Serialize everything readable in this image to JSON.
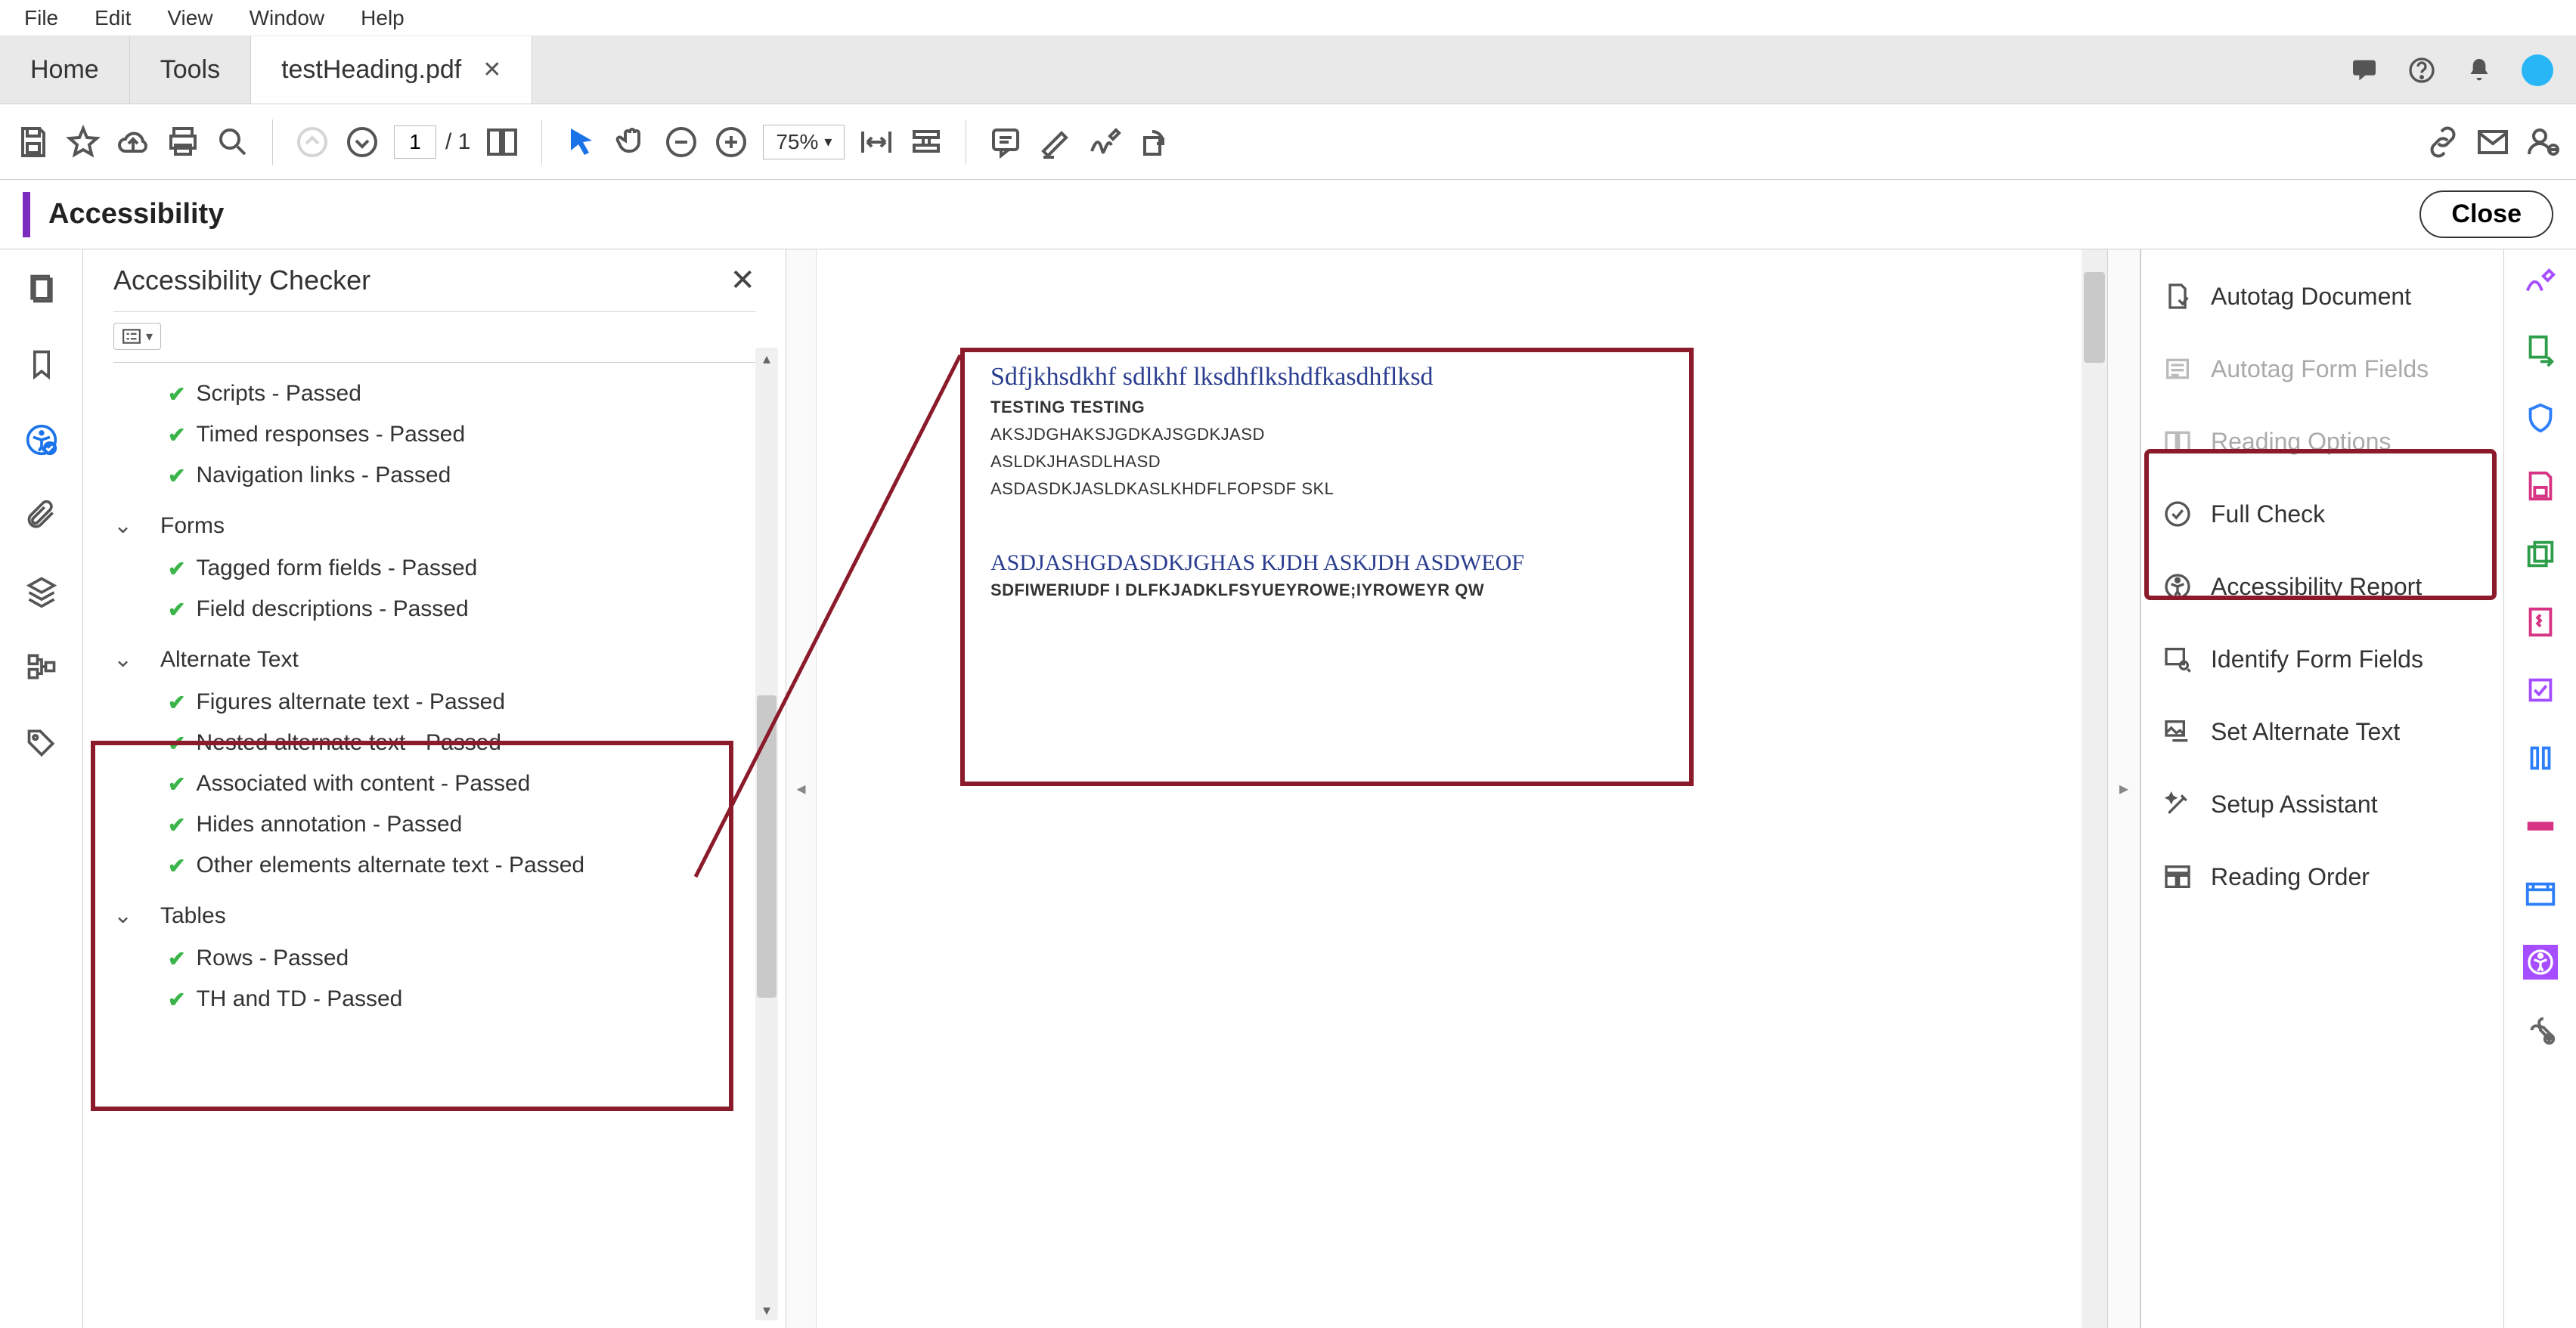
{
  "menu": {
    "file": "File",
    "edit": "Edit",
    "view": "View",
    "window": "Window",
    "help": "Help"
  },
  "tabs": {
    "home": "Home",
    "tools": "Tools",
    "doc": "testHeading.pdf"
  },
  "toolbar": {
    "page_current": "1",
    "page_total": "/  1",
    "zoom_value": "75%"
  },
  "panel": {
    "title": "Accessibility",
    "close": "Close"
  },
  "checker": {
    "title": "Accessibility Checker",
    "items_pre": [
      "Scripts - Passed",
      "Timed responses - Passed",
      "Navigation links - Passed"
    ],
    "group_forms": "Forms",
    "forms_items": [
      "Tagged form fields - Passed",
      "Field descriptions - Passed"
    ],
    "group_alt": "Alternate Text",
    "alt_items": [
      "Figures alternate text - Passed",
      "Nested alternate text - Passed",
      "Associated with content - Passed",
      "Hides annotation - Passed",
      "Other elements alternate text - Passed"
    ],
    "group_tables": "Tables",
    "tables_items": [
      "Rows - Passed",
      "TH and TD - Passed"
    ]
  },
  "doc": {
    "h1": "Sdfjkhsdkhf sdlkhf lksdhflkshdfkasdhflksd",
    "b1": "TESTING TESTING",
    "l1": "AKSJDGHAKSJGDKAJSGDKJASD",
    "l2": "ASLDKJHASDLHASD",
    "l3": "ASDASDKJASLDKASLKHDFLFOPSDF SKL",
    "h2": "ASDJASHGDASDKJGHAS KJDH ASKJDH ASDWEOF",
    "b2": "SDFIWERIUDF I DLFKJADKLFSYUEYROWE;IYROWEYR QW"
  },
  "actions": {
    "autotag_document": "Autotag Document",
    "autotag_form": "Autotag Form Fields",
    "reading_options": "Reading Options",
    "full_check": "Full Check",
    "accessibility_report": "Accessibility Report",
    "identify_form": "Identify Form Fields",
    "set_alt": "Set Alternate Text",
    "setup_assistant": "Setup Assistant",
    "reading_order": "Reading Order"
  }
}
